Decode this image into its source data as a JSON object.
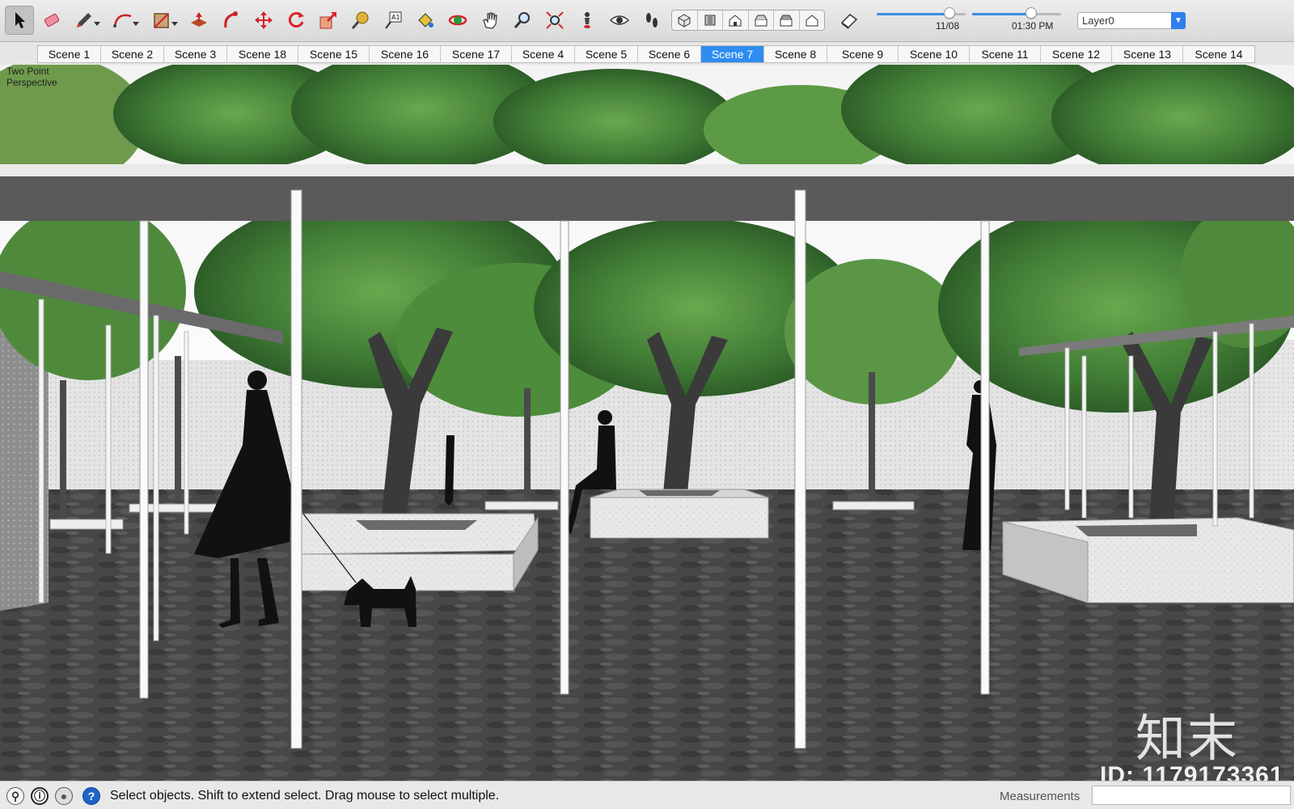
{
  "toolbar": {
    "tools": [
      {
        "name": "select-tool-icon",
        "active": true
      },
      {
        "name": "eraser-tool-icon"
      },
      {
        "name": "pencil-tool-icon",
        "menu": true
      },
      {
        "name": "arc-tool-icon",
        "menu": true
      },
      {
        "name": "rectangle-tool-icon",
        "menu": true
      },
      {
        "name": "push-pull-tool-icon"
      },
      {
        "name": "follow-me-tool-icon"
      },
      {
        "name": "move-tool-icon"
      },
      {
        "name": "rotate-tool-icon"
      },
      {
        "name": "scale-tool-icon"
      },
      {
        "name": "tape-measure-tool-icon"
      },
      {
        "name": "text-tool-icon"
      },
      {
        "name": "paint-bucket-tool-icon"
      },
      {
        "name": "orbit-tool-icon"
      },
      {
        "name": "pan-tool-icon"
      },
      {
        "name": "zoom-tool-icon"
      },
      {
        "name": "zoom-extents-tool-icon"
      },
      {
        "name": "position-camera-tool-icon"
      },
      {
        "name": "look-around-tool-icon"
      },
      {
        "name": "walk-tool-icon"
      }
    ],
    "views": [
      "iso-view-icon",
      "top-view-icon",
      "front-view-icon",
      "right-view-icon",
      "back-view-icon",
      "left-view-icon"
    ],
    "shadow_date": "11/08",
    "shadow_date_level": 0.82,
    "shadow_time": "01:30 PM",
    "shadow_time_level": 0.66,
    "layer": "Layer0"
  },
  "scenes": {
    "tabs": [
      "Scene 1",
      "Scene 2",
      "Scene 3",
      "Scene 18",
      "Scene 15",
      "Scene 16",
      "Scene 17",
      "Scene 4",
      "Scene 5",
      "Scene 6",
      "Scene 7",
      "Scene 8",
      "Scene 9",
      "Scene 10",
      "Scene 11",
      "Scene 12",
      "Scene 13",
      "Scene 14"
    ],
    "selected": "Scene 7"
  },
  "viewport": {
    "camera_label": "Two Point Perspective",
    "watermark_logo": "知末",
    "watermark_id": "ID: 1179173361"
  },
  "statusbar": {
    "hint": "Select objects. Shift to extend select. Drag mouse to select multiple.",
    "measurements_label": "Measurements",
    "measurements_value": ""
  },
  "colors": {
    "accent": "#2e8cf0",
    "canopy": "#3f7a34",
    "ground": "#4a4a4a",
    "roof": "#5a5a5a"
  }
}
